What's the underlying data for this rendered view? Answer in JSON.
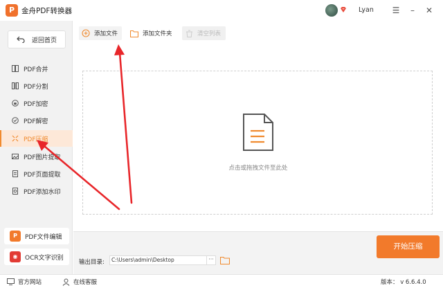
{
  "app": {
    "title": "金舟PDF转换器",
    "logo_text": "P",
    "username": "Lyan"
  },
  "sidebar": {
    "back_label": "返回首页",
    "items": [
      {
        "label": "PDF合并"
      },
      {
        "label": "PDF分割"
      },
      {
        "label": "PDF加密"
      },
      {
        "label": "PDF解密"
      },
      {
        "label": "PDF压缩"
      },
      {
        "label": "PDF图片提取"
      },
      {
        "label": "PDF页面提取"
      },
      {
        "label": "PDF添加水印"
      }
    ],
    "active_index": 4,
    "tools": [
      {
        "label": "PDF文件编辑",
        "icon_text": "P"
      },
      {
        "label": "OCR文字识别",
        "icon_text": "◉"
      }
    ]
  },
  "toolbar": {
    "add_file": "添加文件",
    "add_folder": "添加文件夹",
    "clear_list": "清空列表"
  },
  "dropzone": {
    "hint": "点击或拖拽文件至此处"
  },
  "output": {
    "label": "输出目录:",
    "path": "C:\\Users\\admin\\Desktop",
    "more": "···"
  },
  "actions": {
    "start": "开始压缩"
  },
  "statusbar": {
    "website": "官方网站",
    "support": "在线客服",
    "version": "版本：  v 6.6.4.0"
  },
  "colors": {
    "accent": "#f27a2b",
    "arrow": "#e8262a"
  }
}
